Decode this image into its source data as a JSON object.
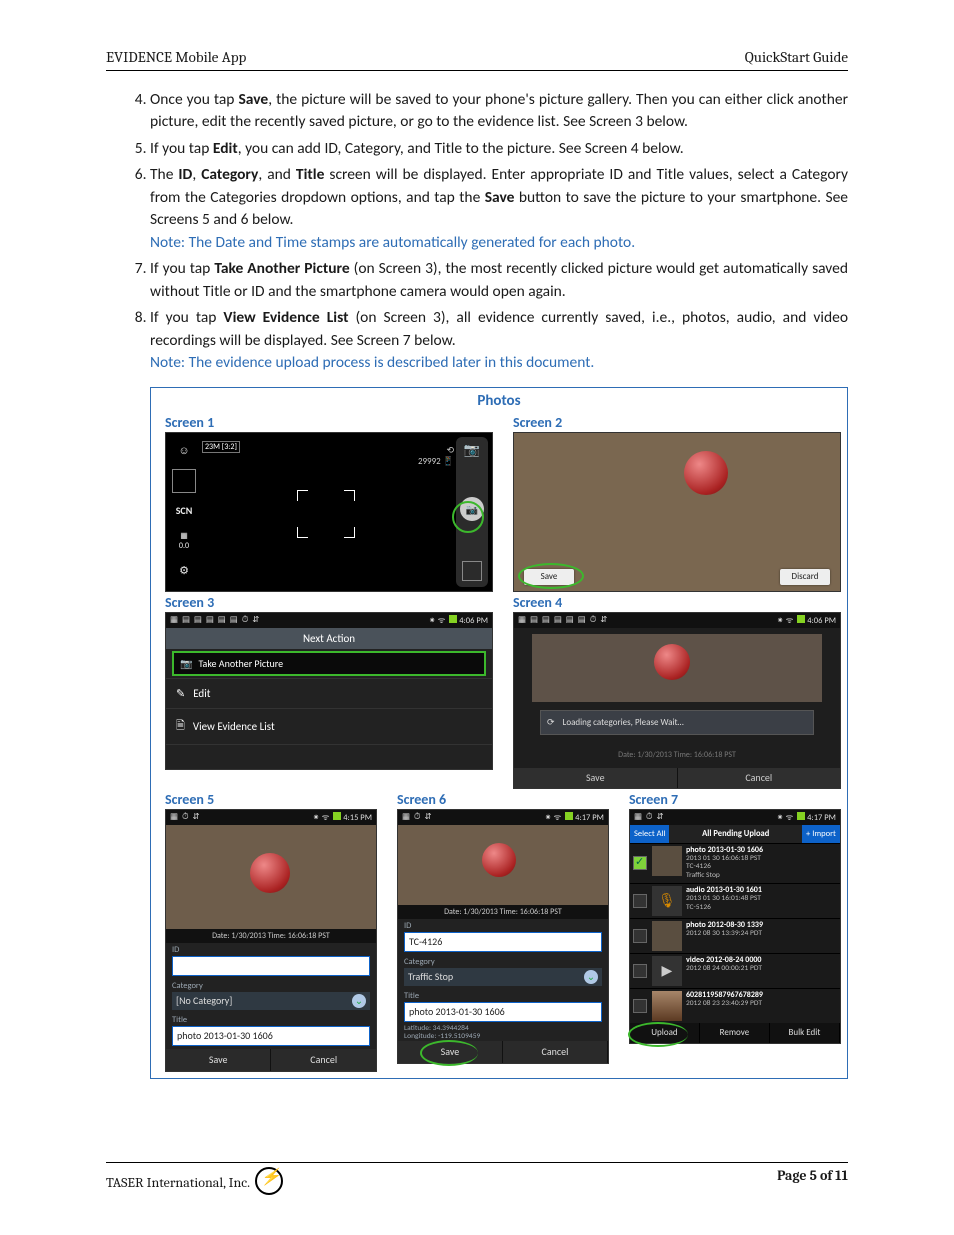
{
  "header": {
    "left": "EVIDENCE Mobile App",
    "right": "QuickStart Guide"
  },
  "instructions": {
    "start": 4,
    "items": [
      {
        "html": "Once you tap <b>Save</b>, the picture will be saved to your phone's picture gallery. Then you can either click another picture, edit the recently saved picture, or go to the evidence list. See Screen 3 below."
      },
      {
        "html": "If you tap <b>Edit</b>, you can add ID, Category, and Title to the picture. See Screen 4 below."
      },
      {
        "html": "The <b>ID</b>, <b>Category</b>, and <b>Title</b> screen will be displayed. Enter appropriate ID and Title values, select a Category from the Categories dropdown options, and tap the <b>Save</b> button to save the picture to your smartphone. See Screens 5 and 6 below.",
        "note": "Note: The Date and Time stamps are automatically generated for each photo."
      },
      {
        "html": "If you tap <b>Take Another Picture</b> (on Screen 3), the most recently clicked picture would get automatically saved without Title or ID and the smartphone camera would open again."
      },
      {
        "html": "If you tap <b>View Evidence List</b> (on Screen 3), all evidence currently saved, i.e., photos, audio, and video recordings will be displayed. See Screen 7 below.",
        "note": "Note: The evidence upload process is described later in this document."
      }
    ]
  },
  "figure": {
    "title": "Photos",
    "labels": {
      "s1": "Screen 1",
      "s2": "Screen 2",
      "s3": "Screen 3",
      "s4": "Screen 4",
      "s5": "Screen 5",
      "s6": "Screen 6",
      "s7": "Screen 7"
    },
    "statusbar": {
      "time406": "4:06 PM",
      "time415": "4:15 PM",
      "time417": "4:17 PM"
    },
    "s1": {
      "scn": "SCN",
      "exp": "0.0",
      "count": "29992",
      "res": "23M [3:2]"
    },
    "s2": {
      "save": "Save",
      "discard": "Discard"
    },
    "s3": {
      "header": "Next Action",
      "take": "Take Another Picture",
      "edit": "Edit",
      "view": "View Evidence List"
    },
    "s4": {
      "loading": "Loading categories, Please Wait…",
      "date": "Date: 1/30/2013 Time: 16:06:18 PST",
      "save": "Save",
      "cancel": "Cancel"
    },
    "s5": {
      "date": "Date: 1/30/2013 Time: 16:06:18 PST",
      "id_label": "ID",
      "id_val": "",
      "cat_label": "Category",
      "cat_val": "[No Category]",
      "title_label": "Title",
      "title_val": "photo 2013-01-30 1606",
      "save": "Save",
      "cancel": "Cancel"
    },
    "s6": {
      "date": "Date: 1/30/2013 Time: 16:06:18 PST",
      "id_label": "ID",
      "id_val": "TC-4126",
      "cat_label": "Category",
      "cat_val": "Traffic Stop",
      "title_label": "Title",
      "title_val": "photo 2013-01-30 1606",
      "lat": "Latitude: 34.3944284",
      "lon": "Longitude: -119.5109459",
      "save": "Save",
      "cancel": "Cancel"
    },
    "s7": {
      "select_all": "Select All",
      "pending": "All Pending Upload",
      "import": "+ Import",
      "items": [
        {
          "checked": true,
          "kind": "photo",
          "title": "photo 2013-01-30 1606",
          "sub1": "2013 01 30 16:06:18 PST",
          "sub2": "TC-4126",
          "sub3": "Traffic Stop"
        },
        {
          "checked": false,
          "kind": "audio",
          "title": "audio 2013-01-30 1601",
          "sub1": "2013 01 30 16:01:48 PST",
          "sub2": "TC-5126",
          "sub3": ""
        },
        {
          "checked": false,
          "kind": "photo",
          "title": "photo 2012-08-30 1339",
          "sub1": "2012 08 30 13:39:24 PDT",
          "sub2": "",
          "sub3": ""
        },
        {
          "checked": false,
          "kind": "video",
          "title": "video 2012-08-24 0000",
          "sub1": "2012 08 24 00:00:21 PDT",
          "sub2": "",
          "sub3": ""
        },
        {
          "checked": false,
          "kind": "sky",
          "title": "6028119587967678289",
          "sub1": "2012 08 23 23:40:29 PDT",
          "sub2": "",
          "sub3": ""
        }
      ],
      "upload": "Upload",
      "remove": "Remove",
      "bulk": "Bulk Edit"
    }
  },
  "footer": {
    "company": "TASER International, Inc.",
    "page": "Page 5 of 11"
  }
}
